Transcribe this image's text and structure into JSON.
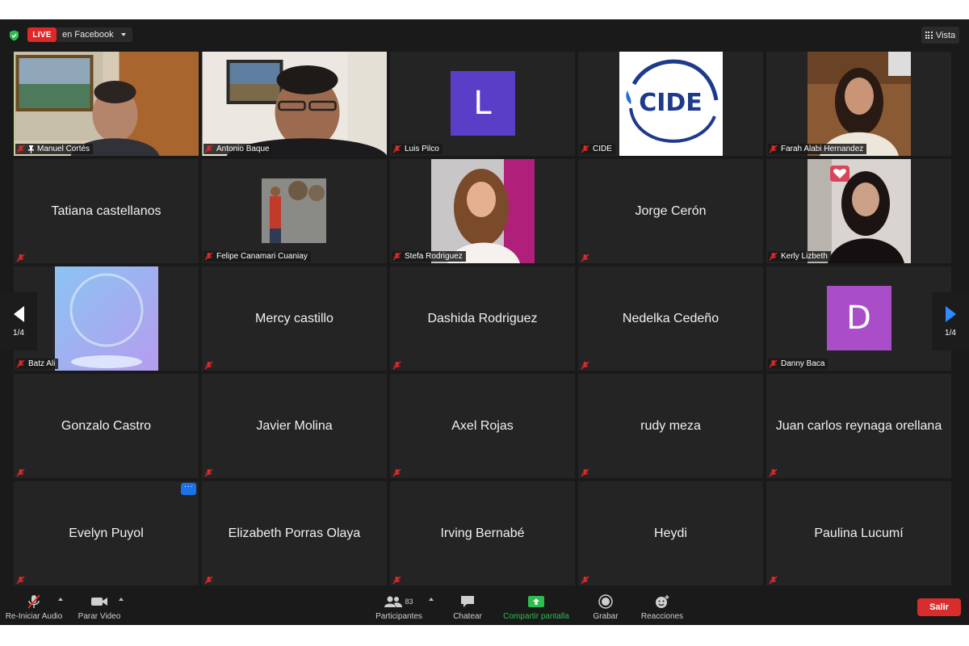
{
  "top_bar": {
    "live_label": "LIVE",
    "live_destination": "en Facebook",
    "view_label": "Vista"
  },
  "participants": [
    {
      "name": "Manuel Cortés",
      "video": true,
      "active_speaker": true,
      "pinned": true
    },
    {
      "name": "Antonio Baque",
      "video": true
    },
    {
      "name": "Luis Pilco",
      "avatar_letter": "L",
      "avatar_color": "#5b3ec8"
    },
    {
      "name": "CIDE",
      "logo_text": "CIDE"
    },
    {
      "name": "Farah Alabi Hernandez",
      "video": true
    },
    {
      "name": "Tatiana castellanos"
    },
    {
      "name": "Felipe Canamari Cuaniay",
      "video": true
    },
    {
      "name": "Stefa Rodriguez",
      "video": true
    },
    {
      "name": "Jorge Cerón"
    },
    {
      "name": "Kerly Lizbeth",
      "video": true
    },
    {
      "name": "Batz Ali",
      "video": true
    },
    {
      "name": "Mercy castillo"
    },
    {
      "name": "Dashida Rodriguez"
    },
    {
      "name": "Nedelka Cedeño"
    },
    {
      "name": "Danny Baca",
      "avatar_letter": "D",
      "avatar_color": "#a94ec8"
    },
    {
      "name": "Gonzalo Castro"
    },
    {
      "name": "Javier Molina"
    },
    {
      "name": "Axel Rojas"
    },
    {
      "name": "rudy meza"
    },
    {
      "name": "Juan carlos reynaga orellana"
    },
    {
      "name": "Evelyn Puyol",
      "more_menu": "···"
    },
    {
      "name": "Elizabeth Porras Olaya"
    },
    {
      "name": "Irving Bernabé"
    },
    {
      "name": "Heydi"
    },
    {
      "name": "Paulina Lucumí"
    }
  ],
  "pagination": {
    "left": "1/4",
    "right": "1/4"
  },
  "toolbar": {
    "audio_label": "Re-Iniciar Audio",
    "video_label": "Parar Video",
    "participants_label": "Participantes",
    "participants_count": "83",
    "chat_label": "Chatear",
    "share_label": "Compartir pantalla",
    "record_label": "Grabar",
    "reactions_label": "Reacciones",
    "leave_label": "Salir"
  },
  "colors": {
    "background": "#1a1a1a",
    "tile": "#242424",
    "live_red": "#e02828",
    "active_speaker_border": "#b5d36a",
    "share_green": "#2dbd4f",
    "leave_red": "#d92d2d",
    "nav_blue": "#2d8cff",
    "mute_red": "#e02828"
  }
}
